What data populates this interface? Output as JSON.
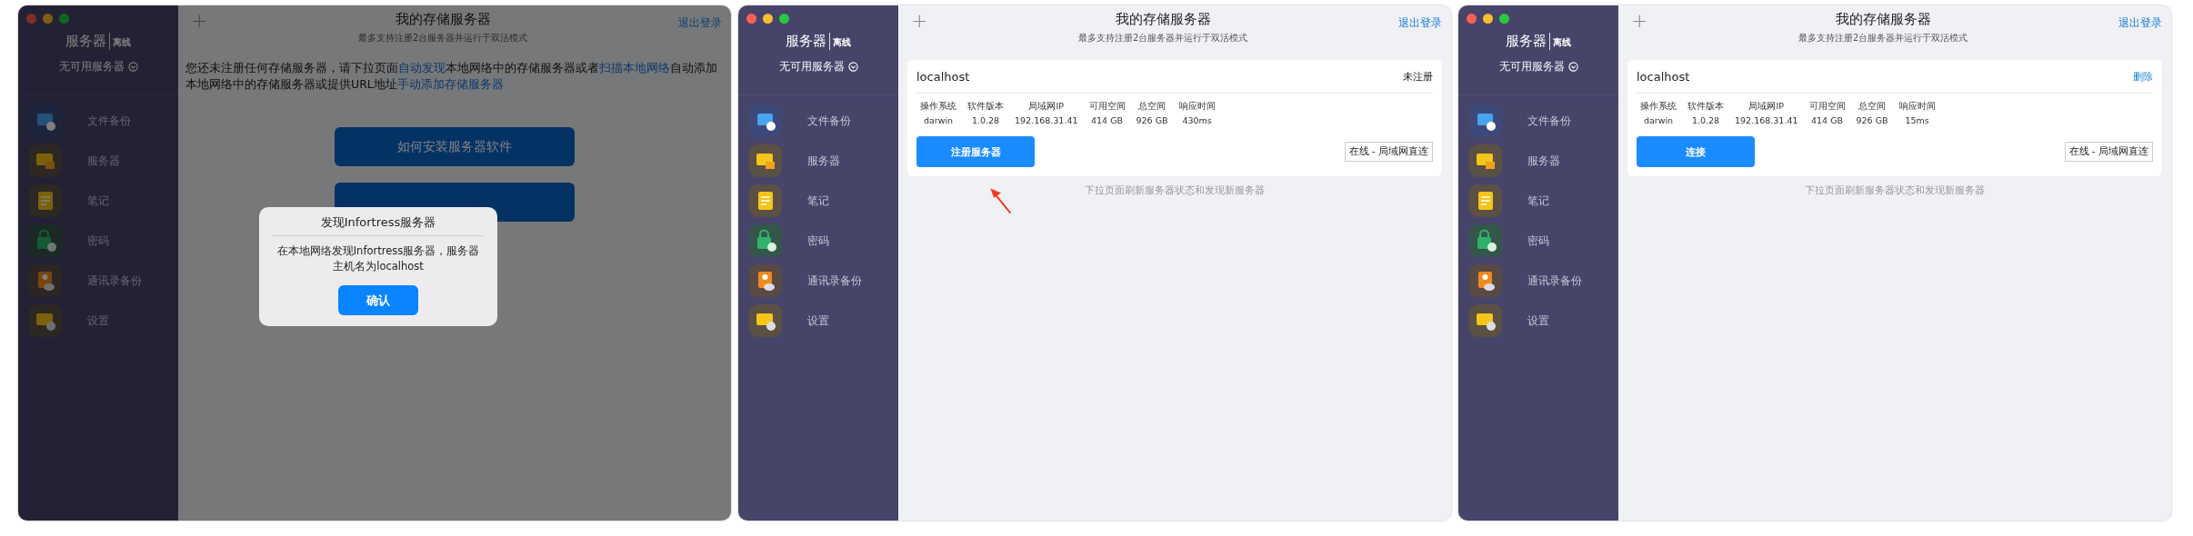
{
  "windows": [
    {
      "dimmed": true,
      "sidebar": {
        "title": "服务器",
        "status": "离线",
        "server_picker": "无可用服务器",
        "items": [
          {
            "label": "文件备份",
            "kind": "file"
          },
          {
            "label": "服务器",
            "kind": "server"
          },
          {
            "label": "笔记",
            "kind": "note"
          },
          {
            "label": "密码",
            "kind": "password"
          },
          {
            "label": "通讯录备份",
            "kind": "contacts"
          },
          {
            "label": "设置",
            "kind": "settings"
          }
        ]
      },
      "header": {
        "add": "+",
        "title": "我的存储服务器",
        "subtitle": "最多支持注册2台服务器并运行于双活模式",
        "logout": "退出登录"
      },
      "content": {
        "kind": "empty",
        "message": [
          {
            "text": "您还未注册任何存储服务器，请下拉页面",
            "link": false
          },
          {
            "text": "自动发现",
            "link": true
          },
          {
            "text": "本地网络中的存储服务器或者",
            "link": false
          },
          {
            "text": "扫描本地网络",
            "link": true
          },
          {
            "text": "自动添加本地网络中的存储服务器或提供URL地址",
            "link": false
          },
          {
            "text": "手动添加存储服务器",
            "link": true
          }
        ],
        "buttons": [
          {
            "kind": "labeled",
            "label": "如何安装服务器软件"
          },
          {
            "kind": "covered"
          }
        ],
        "dialog": {
          "title": "发现Infortress服务器",
          "message": "在本地网络发现Infortress服务器，服务器主机名为localhost",
          "button": "确认"
        }
      }
    },
    {
      "dimmed": false,
      "pointer_arrow": true,
      "sidebar": {
        "title": "服务器",
        "status": "离线",
        "server_picker": "无可用服务器",
        "items": [
          {
            "label": "文件备份",
            "kind": "file"
          },
          {
            "label": "服务器",
            "kind": "server"
          },
          {
            "label": "笔记",
            "kind": "note"
          },
          {
            "label": "密码",
            "kind": "password"
          },
          {
            "label": "通讯录备份",
            "kind": "contacts"
          },
          {
            "label": "设置",
            "kind": "settings"
          }
        ]
      },
      "header": {
        "add": "+",
        "title": "我的存储服务器",
        "subtitle": "最多支持注册2台服务器并运行于双活模式",
        "logout": "退出登录"
      },
      "content": {
        "kind": "server",
        "host": "localhost",
        "action": {
          "text": "未注册",
          "link": false
        },
        "stats": [
          {
            "label": "操作系统",
            "value": "darwin"
          },
          {
            "label": "软件版本",
            "value": "1.0.28"
          },
          {
            "label": "局域网IP",
            "value": "192.168.31.41"
          },
          {
            "label": "可用空间",
            "value": "414 GB"
          },
          {
            "label": "总空间",
            "value": "926 GB"
          },
          {
            "label": "响应时间",
            "value": "430ms"
          }
        ],
        "button": "注册服务器",
        "status": "在线 - 局域网直连",
        "hint": "下拉页面刷新服务器状态和发现新服务器"
      }
    },
    {
      "dimmed": false,
      "sidebar": {
        "title": "服务器",
        "status": "离线",
        "server_picker": "无可用服务器",
        "items": [
          {
            "label": "文件备份",
            "kind": "file"
          },
          {
            "label": "服务器",
            "kind": "server"
          },
          {
            "label": "笔记",
            "kind": "note"
          },
          {
            "label": "密码",
            "kind": "password"
          },
          {
            "label": "通讯录备份",
            "kind": "contacts"
          },
          {
            "label": "设置",
            "kind": "settings"
          }
        ]
      },
      "header": {
        "add": "+",
        "title": "我的存储服务器",
        "subtitle": "最多支持注册2台服务器并运行于双活模式",
        "logout": "退出登录"
      },
      "content": {
        "kind": "server",
        "host": "localhost",
        "action": {
          "text": "删除",
          "link": true
        },
        "stats": [
          {
            "label": "操作系统",
            "value": "darwin"
          },
          {
            "label": "软件版本",
            "value": "1.0.28"
          },
          {
            "label": "局域网IP",
            "value": "192.168.31.41"
          },
          {
            "label": "可用空间",
            "value": "414 GB"
          },
          {
            "label": "总空间",
            "value": "926 GB"
          },
          {
            "label": "响应时间",
            "value": "15ms"
          }
        ],
        "button": "连接",
        "status": "在线 - 局域网直连",
        "hint": "下拉页面刷新服务器状态和发现新服务器"
      }
    }
  ]
}
